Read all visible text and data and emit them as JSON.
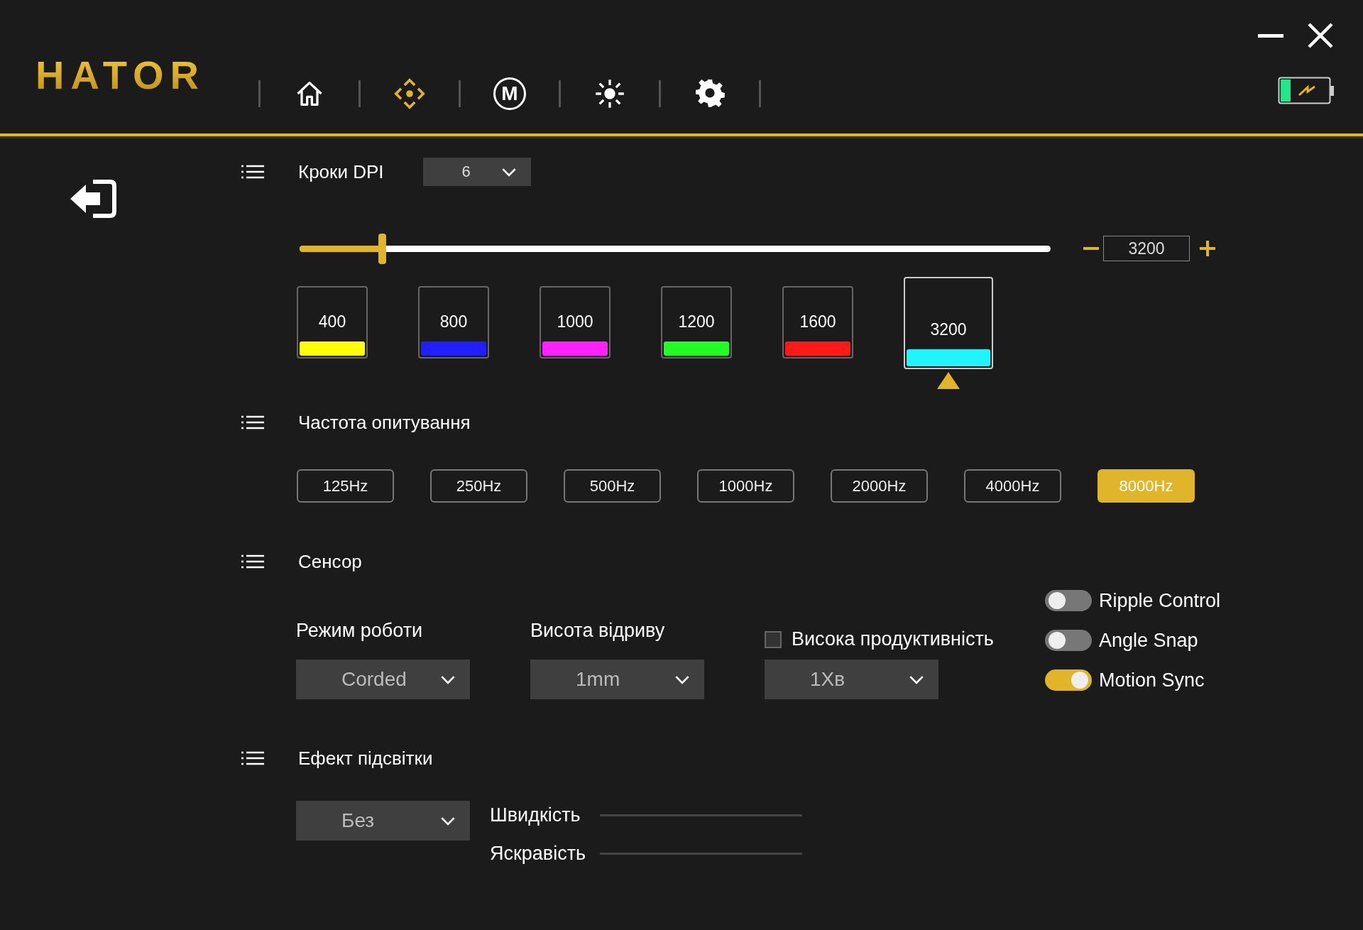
{
  "header": {
    "logo": "HATOR",
    "nav": [
      {
        "kind": "home",
        "selected": false
      },
      {
        "kind": "move",
        "selected": true
      },
      {
        "kind": "macro",
        "label": "M",
        "selected": false
      },
      {
        "kind": "light",
        "selected": false
      },
      {
        "kind": "settings",
        "selected": false
      }
    ]
  },
  "dpi": {
    "title": "Кроки DPI",
    "steps": "6",
    "slider": {
      "level": 0.11
    },
    "value": "3200",
    "stages": [
      {
        "value": "400",
        "color": "#ffff00",
        "selected": false
      },
      {
        "value": "800",
        "color": "#1f1fff",
        "selected": false
      },
      {
        "value": "1000",
        "color": "#ff22ff",
        "selected": false
      },
      {
        "value": "1200",
        "color": "#22ff22",
        "selected": false
      },
      {
        "value": "1600",
        "color": "#ff1a1a",
        "selected": false
      },
      {
        "value": "3200",
        "color": "#22f4ff",
        "selected": true
      }
    ]
  },
  "polling": {
    "title": "Частота опитування",
    "rates": [
      {
        "label": "125Hz",
        "selected": false
      },
      {
        "label": "250Hz",
        "selected": false
      },
      {
        "label": "500Hz",
        "selected": false
      },
      {
        "label": "1000Hz",
        "selected": false
      },
      {
        "label": "2000Hz",
        "selected": false
      },
      {
        "label": "4000Hz",
        "selected": false
      },
      {
        "label": "8000Hz",
        "selected": true
      }
    ]
  },
  "sensor": {
    "title": "Сенсор",
    "dropdowns": [
      {
        "label": "Режим роботи",
        "value": "Corded",
        "kind": "plain"
      },
      {
        "label": "Висота відриву",
        "value": "1mm",
        "kind": "plain"
      },
      {
        "label": "Висока продуктивність",
        "value": "1Хв",
        "kind": "checkbox",
        "checked": false
      }
    ],
    "toggles": [
      {
        "label": "Ripple Control",
        "on": false
      },
      {
        "label": "Angle Snap",
        "on": false
      },
      {
        "label": "Motion Sync",
        "on": true
      }
    ]
  },
  "lighting": {
    "title": "Ефект підсвітки",
    "effect": "Без",
    "sliders": [
      {
        "label": "Швидкість"
      },
      {
        "label": "Яскравість"
      }
    ]
  }
}
